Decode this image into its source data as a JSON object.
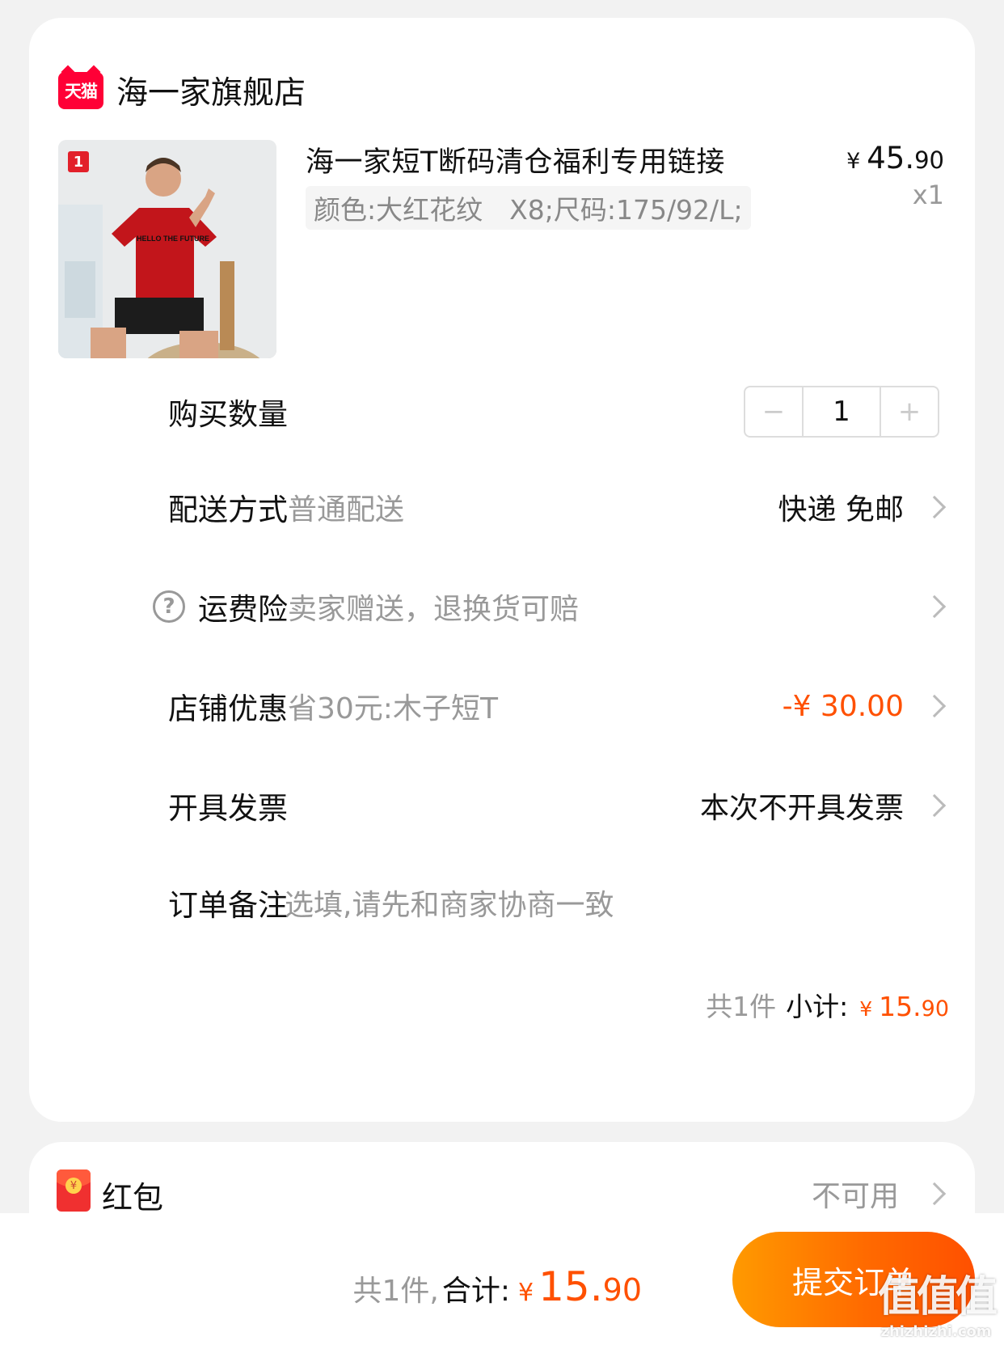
{
  "shop": {
    "badge": "天猫",
    "name": "海一家旗舰店"
  },
  "product": {
    "image_alt": "红色T恤模特图",
    "image_badge": "1",
    "shirt_text": "HELLO THE FUTURE",
    "title": "海一家短T断码清仓福利专用链接",
    "spec": "颜色:大红花纹　X8;尺码:175/92/L;",
    "price_yen": "¥",
    "price_int": "45.",
    "price_dec": "90",
    "qty": "x1"
  },
  "rows": {
    "quantity": {
      "label": "购买数量",
      "value": "1",
      "minus": "−",
      "plus": "+"
    },
    "delivery": {
      "label": "配送方式",
      "desc": "普通配送",
      "value": "快递 免邮"
    },
    "insurance": {
      "label": "运费险",
      "desc": "卖家赠送，退换货可赔",
      "icon": "help-circle-icon"
    },
    "discount": {
      "label": "店铺优惠",
      "desc": "省30元:木子短T",
      "value": "-¥ 30.00"
    },
    "invoice": {
      "label": "开具发票",
      "value": "本次不开具发票"
    },
    "remark": {
      "label": "订单备注",
      "placeholder": "选填,请先和商家协商一致"
    }
  },
  "subtotal": {
    "count": "共1件",
    "label": "小计:",
    "yen": "¥",
    "int": "15.",
    "dec": "90"
  },
  "red_packet": {
    "label": "红包",
    "status": "不可用",
    "coin": "¥"
  },
  "bottom": {
    "count": "共1件,",
    "label": "合计:",
    "yen": "¥",
    "int": "15.",
    "dec": "90",
    "submit": "提交订单"
  },
  "watermark": {
    "main": "值值值",
    "sub": "zhizhizhi.com"
  },
  "colors": {
    "accent": "#ff5000",
    "tmall_red": "#ff0036"
  }
}
